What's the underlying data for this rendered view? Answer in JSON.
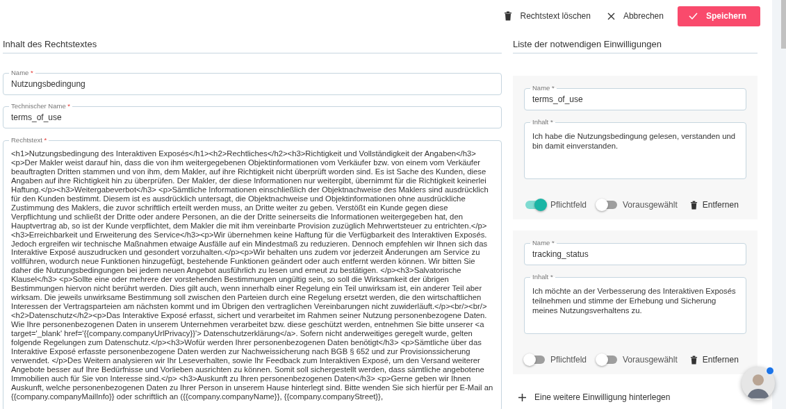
{
  "toolbar": {
    "delete_button": "Rechtstext löschen",
    "cancel_button": "Abbrechen",
    "save_button": "Speichern"
  },
  "content_section": {
    "title": "Inhalt des Rechtstextes",
    "fields": [
      {
        "kind": "input",
        "label": "Name",
        "required_mark": "*",
        "value": "Nutzungsbedingung"
      },
      {
        "kind": "input",
        "label": "Technischer Name",
        "required_mark": "*",
        "value": "terms_of_use"
      },
      {
        "kind": "textarea",
        "label": "Rechtstext",
        "required_mark": "*",
        "value": "<h1>Nutzungsbedingung des Interaktiven Exposés</h1><h2>Rechtliches</h2><h3>Richtigkeit und Vollständigkeit der Angaben</h3> <p>Der Makler weist darauf hin, dass die von ihm weitergegebenen Objektinformationen vom Verkäufer bzw. von einem vom Verkäufer beauftragten Dritten stammen und von ihm, dem Makler, auf ihre Richtigkeit nicht überprüft worden sind. Es ist Sache des Kunden, diese Angaben auf ihre Richtigkeit hin zu überprüfen. Der Makler, der diese Informationen nur weitergibt, übernimmt für die Richtigkeit keinerlei Haftung.</p><h3>Weitergabeverbot</h3> <p>Sämtliche Informationen einschließlich der Objektnachweise des Maklers sind ausdrücklich für den Kunden bestimmt. Diesem ist es ausdrücklich untersagt, die Objektnachweise und Objektinformationen ohne ausdrückliche Zustimmung des Maklers, die zuvor schriftlich erteilt werden muss, an Dritte weiter zu geben. Verstößt ein Kunde gegen diese Verpflichtung und schließt der Dritte oder andere Personen, an die der Dritte seinerseits die Informationen weitergegeben hat, den Hauptvertrag ab, so ist der Kunde verpflichtet, dem Makler die mit ihm vereinbarte Provision zuzüglich Mehrwertsteuer zu entrichten.</p> <h3>Erreichbarkeit und Erweiterung des Service</h3><p>Wir übernehmen keine Haftung für die Verfügbarkeit des Interaktiven Exposés. Jedoch ergreifen wir technische Maßnahmen etwaige Ausfälle auf ein Mindestmaß zu reduzieren. Dennoch empfehlen wir Ihnen sich das Interaktive Exposé auszudrucken und gesondert vorzuhalten.</p><p>Wir behalten uns zudem vor jederzeit Änderungen am Service zu vollführen, wodurch neue Funktionen hinzugefügt, bestehende Funktionen geändert oder auch entfernt werden können. Wir bitten Sie daher die Nutzungsbedingungen bei jedem neuen Angebot ausführlich zu lesen und erneut zu bestätigen. </p><h3>Salvatorische Klausel</h3> <p>Sollte eine oder mehrere der vorstehenden Bestimmungen ungültig sein, so soll die Wirksamkeit der übrigen Bestimmungen hiervon nicht berührt werden. Dies gilt auch, wenn innerhalb einer Regelung ein Teil unwirksam ist, ein anderer Teil aber wirksam. Die jeweils unwirksame Bestimmung soll zwischen den Parteien durch eine Regelung ersetzt werden, die den wirtschaftlichen Interessen der Vertragsparteien am nächsten kommt und im Übrigen den vertraglichen Vereinbarungen nicht zuwiderläuft.</p><br/><br/> <h2>Datenschutz</h2><p>Das Interaktive Exposé erfasst, sichert und verarbeitet im Rahmen seiner Nutzung personenbezogene Daten. Wie Ihre personenbezogenen Daten in unserem Unternehmen verarbeitet bzw. diese geschützt werden, entnehmen Sie bitte unserer <a target='_blank' href='{{company.companyUrlPrivacy}}'> Datenschutzerklärung</a>. Sofern nicht anderweitiges geregelt wurde, gelten folgende Regelungen zum Datenschutz.</p><h3>Wofür werden Ihrer personenbezogenen Daten benötigt</h3> <p>Sämtliche über das Interaktive Exposé erfasste personenbezogene Daten werden zur Nachweissicherung nach BGB § 652 und zur Provisionssicherung verwendet. </p>Des Weitern analysieren wir Ihr Leseverhalten, sowie Ihr Feedback zum Interaktiven Exposé, um den Versand weiterer Angebote besser auf Ihre Bedürfnisse und Vorlieben ausrichten zu können. Somit soll sichergestellt werden, dass sämtliche angebotene Immobilien auch für Sie von Interesse sind.</p> <h3>Auskunft zu Ihren personenbezogenen Daten</h3> <p>Gerne geben wir Ihnen Auskunft, welche personenbezogenen Daten zu Ihrer Person in unserem Hause hinterlegt sind. Bitte wenden Sie sich hierfür per E-Mail an {{company.companyMailInfo}} oder schriftlich an ({{company.companyName}}, {{company.companyStreet}},"
      }
    ]
  },
  "consents_section": {
    "title": "Liste der notwendigen Einwilligungen",
    "consents": [
      {
        "name_field": {
          "label": "Name",
          "required_mark": "*",
          "value": "terms_of_use"
        },
        "content_field": {
          "label": "Inhalt",
          "required_mark": "*",
          "value": "Ich habe die Nutzungsbedingung gelesen, verstanden und bin damit einverstanden."
        },
        "toggles": [
          {
            "label": "Pflichtfeld",
            "on": true
          },
          {
            "label": "Vorausgewählt",
            "on": false
          }
        ],
        "remove_button": "Entfernen"
      },
      {
        "name_field": {
          "label": "Name",
          "required_mark": "*",
          "value": "tracking_status"
        },
        "content_field": {
          "label": "Inhalt",
          "required_mark": "*",
          "value": "Ich möchte an der Verbesserung des Interaktiven Exposés teilnehmen und stimme der Erhebung und Sicherung meines Nutzungsverhaltens zu."
        },
        "toggles": [
          {
            "label": "Pflichtfeld",
            "on": false
          },
          {
            "label": "Vorausgewählt",
            "on": false
          }
        ],
        "remove_button": "Entfernen"
      }
    ],
    "add_button": "Eine weitere Einwilligung hinterlegen"
  },
  "chat_avatar": {
    "notification": true
  }
}
